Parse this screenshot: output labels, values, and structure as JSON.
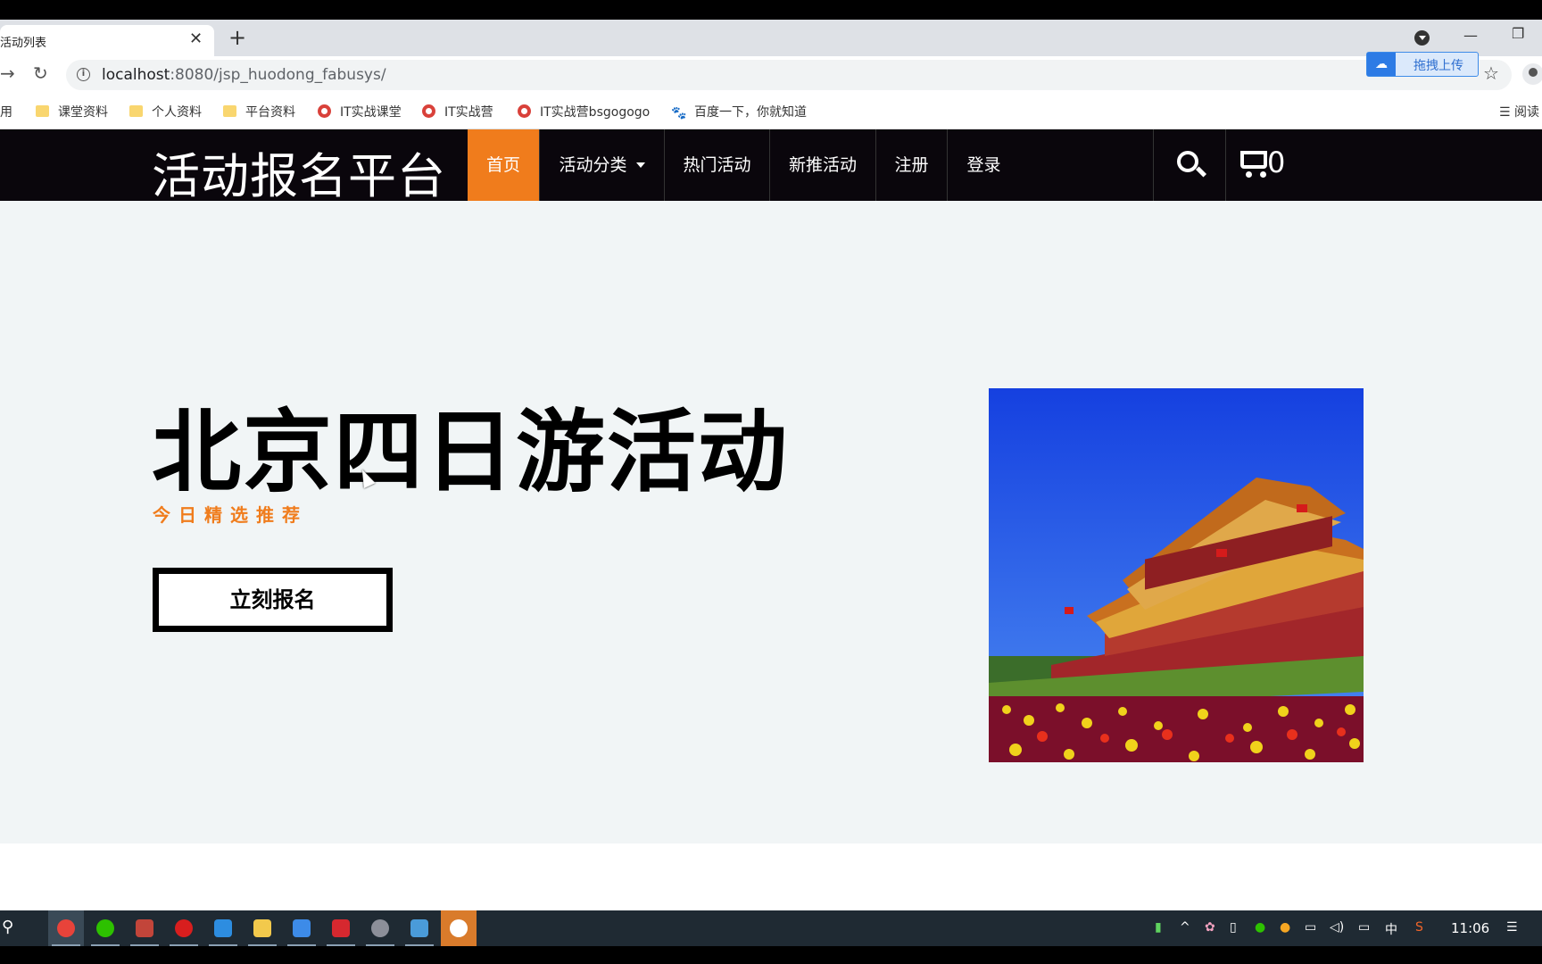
{
  "browser": {
    "tab_title": "活动列表",
    "url_host": "localhost",
    "url_path": ":8080/jsp_huodong_fabusys/",
    "upload_label": "拖拽上传",
    "reader_label": "阅读",
    "bookmarks": [
      {
        "label": "应用",
        "icon": "apps-icon"
      },
      {
        "label": "课堂资料",
        "icon": "folder-icon"
      },
      {
        "label": "个人资料",
        "icon": "folder-icon"
      },
      {
        "label": "平台资料",
        "icon": "folder-icon"
      },
      {
        "label": "IT实战课堂",
        "icon": "chrome-icon"
      },
      {
        "label": "IT实战营",
        "icon": "chrome-icon"
      },
      {
        "label": "IT实战营bsgogogo",
        "icon": "chrome-icon"
      },
      {
        "label": "百度一下，你就知道",
        "icon": "baidu-paw-icon"
      }
    ]
  },
  "site": {
    "logo": "活动报名平台",
    "menu": [
      {
        "label": "首页",
        "active": true
      },
      {
        "label": "活动分类",
        "dropdown": true
      },
      {
        "label": "热门活动"
      },
      {
        "label": "新推活动"
      },
      {
        "label": "注册"
      },
      {
        "label": "登录"
      }
    ],
    "cart_count": "0",
    "accent_color": "#f07c1c",
    "nav_bg": "#0a060c"
  },
  "hero": {
    "title": "北京四日游活动",
    "subtitle": "今日精选推荐",
    "button": "立刻报名",
    "image_alt": "天安门"
  },
  "taskbar": {
    "clock": "11:06",
    "ime": "中"
  }
}
